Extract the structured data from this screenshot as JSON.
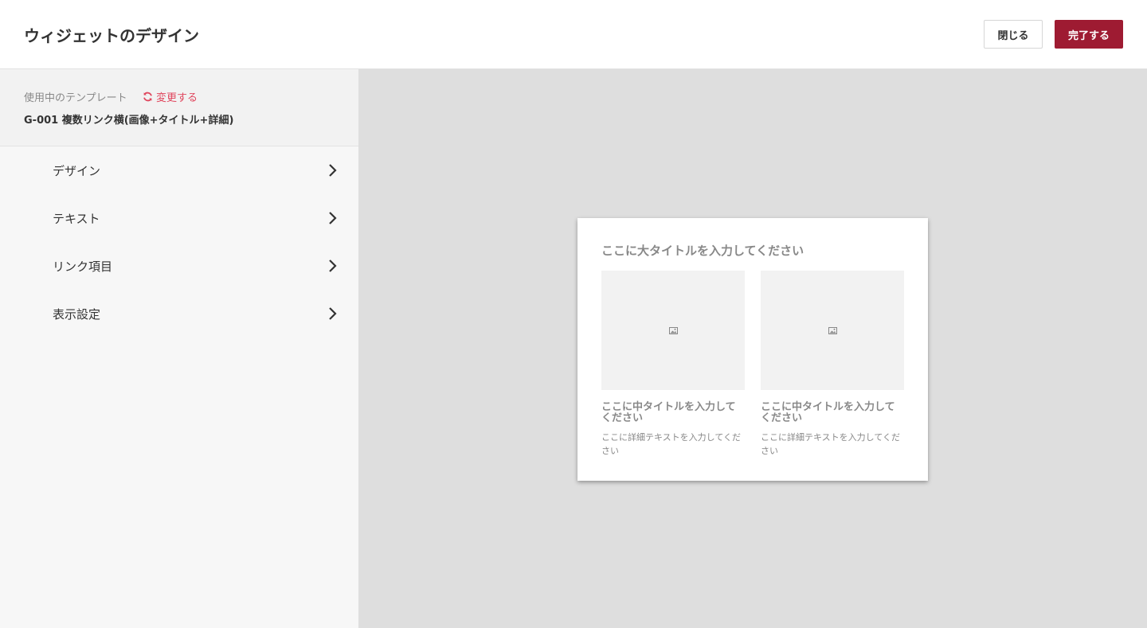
{
  "header": {
    "title": "ウィジェットのデザイン",
    "close_label": "閉じる",
    "done_label": "完了する"
  },
  "colors": {
    "accent": "#9e1b32",
    "link": "#e0475e",
    "canvas_bg": "#dedede"
  },
  "sidebar": {
    "template_label": "使用中のテンプレート",
    "change_label": "変更する",
    "change_icon": "refresh-icon",
    "template_name": "G-001 複数リンク横(画像+タイトル+詳細)",
    "menu": [
      {
        "label": "デザイン",
        "icon": "chevron-right-icon"
      },
      {
        "label": "テキスト",
        "icon": "chevron-right-icon"
      },
      {
        "label": "リンク項目",
        "icon": "chevron-right-icon"
      },
      {
        "label": "表示設定",
        "icon": "chevron-right-icon"
      }
    ]
  },
  "preview": {
    "title": "ここに大タイトルを入力してください",
    "cards": [
      {
        "image_icon": "image-icon",
        "title": "ここに中タイトルを入力してください",
        "text": "ここに詳細テキストを入力してください"
      },
      {
        "image_icon": "image-icon",
        "title": "ここに中タイトルを入力してください",
        "text": "ここに詳細テキストを入力してください"
      }
    ]
  }
}
